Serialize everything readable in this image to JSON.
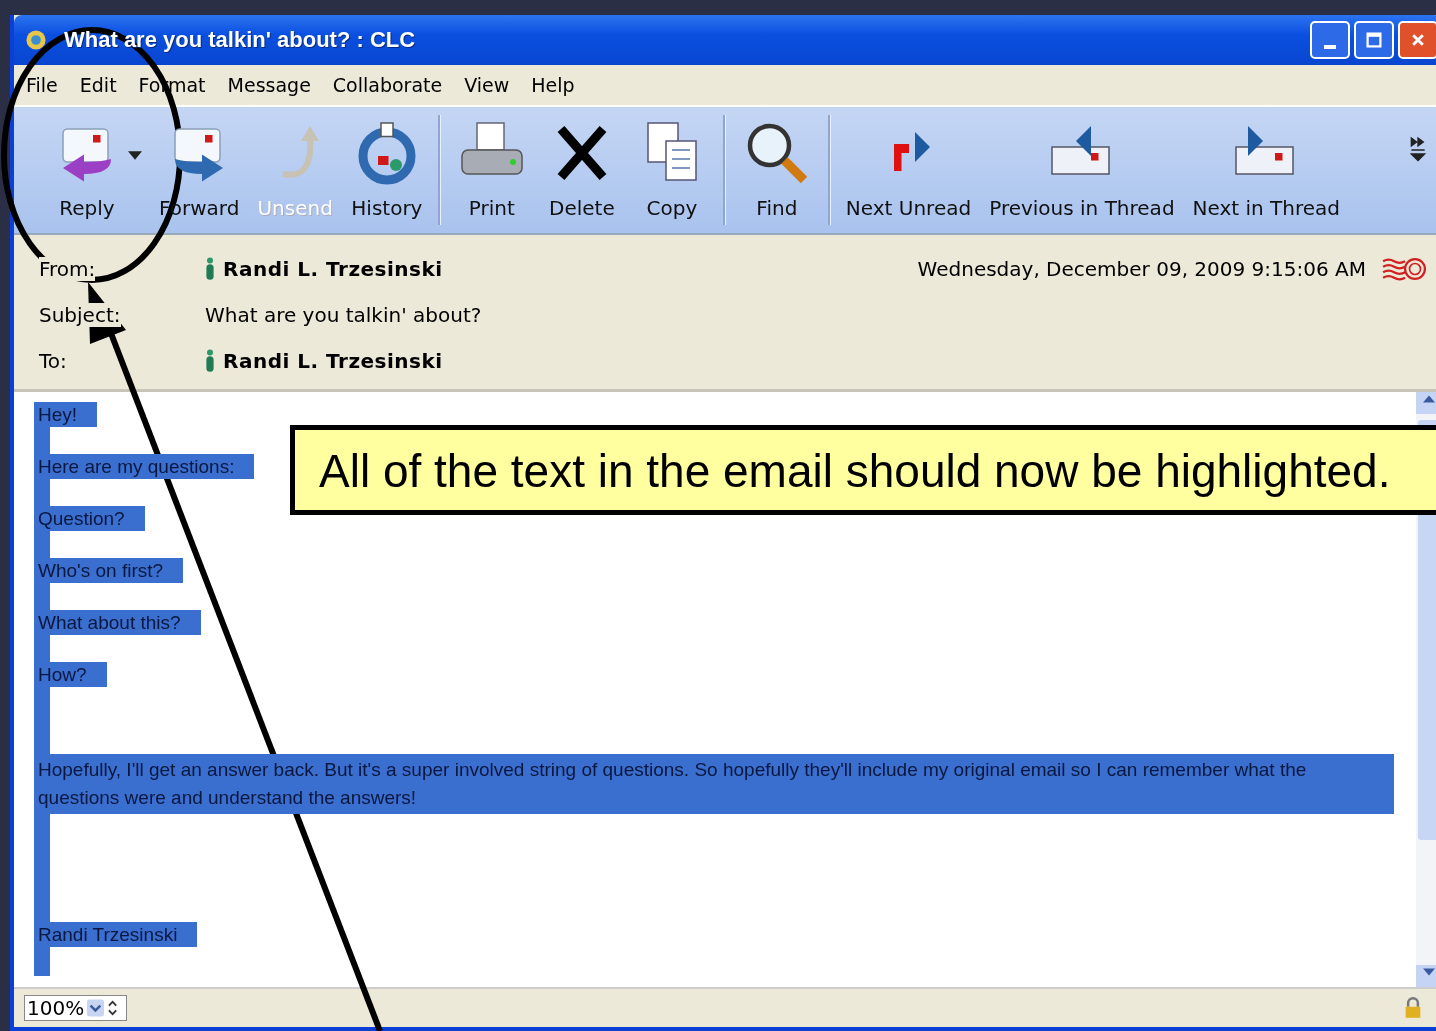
{
  "window": {
    "title": "What are you talkin' about? : CLC"
  },
  "menu": [
    "File",
    "Edit",
    "Format",
    "Message",
    "Collaborate",
    "View",
    "Help"
  ],
  "toolbar": [
    {
      "label": "Reply",
      "kind": "reply",
      "disabled": false,
      "group_end": false
    },
    {
      "label": "Forward",
      "kind": "forward",
      "disabled": false,
      "group_end": false
    },
    {
      "label": "Unsend",
      "kind": "unsend",
      "disabled": true,
      "group_end": false
    },
    {
      "label": "History",
      "kind": "history",
      "disabled": false,
      "group_end": true
    },
    {
      "label": "Print",
      "kind": "print",
      "disabled": false,
      "group_end": false
    },
    {
      "label": "Delete",
      "kind": "delete",
      "disabled": false,
      "group_end": false
    },
    {
      "label": "Copy",
      "kind": "copy",
      "disabled": false,
      "group_end": true
    },
    {
      "label": "Find",
      "kind": "find",
      "disabled": false,
      "group_end": true
    },
    {
      "label": "Next Unread",
      "kind": "next_unread",
      "disabled": false,
      "group_end": false
    },
    {
      "label": "Previous in Thread",
      "kind": "prev_thread",
      "disabled": false,
      "group_end": false
    },
    {
      "label": "Next in Thread",
      "kind": "next_thread",
      "disabled": false,
      "group_end": false
    }
  ],
  "header": {
    "from_label": "From:",
    "from": "Randi L. Trzesinski",
    "date": "Wednesday, December 09, 2009 9:15:06 AM",
    "subject_label": "Subject:",
    "subject": "What are you talkin' about?",
    "to_label": "To:",
    "to": "Randi L. Trzesinski"
  },
  "body": {
    "selected": true,
    "lines": [
      {
        "text": "Hey!",
        "kind": "line"
      },
      {
        "text": "Here are my questions:",
        "kind": "line"
      },
      {
        "text": "Question?",
        "kind": "line"
      },
      {
        "text": "Who's on first?",
        "kind": "line"
      },
      {
        "text": "What about this?",
        "kind": "line"
      },
      {
        "text": "How?",
        "kind": "line"
      },
      {
        "text": "Hopefully, I'll get an answer back. But it's a super involved string of questions. So hopefully they'll include my original email so I can remember what the questions were and understand the answers!",
        "kind": "paragraph"
      },
      {
        "text": "Randi Trzesinski",
        "kind": "signature"
      }
    ]
  },
  "status_bar": {
    "zoom": "100%"
  },
  "callout": {
    "text": "All of the text in the email should now be highlighted."
  }
}
